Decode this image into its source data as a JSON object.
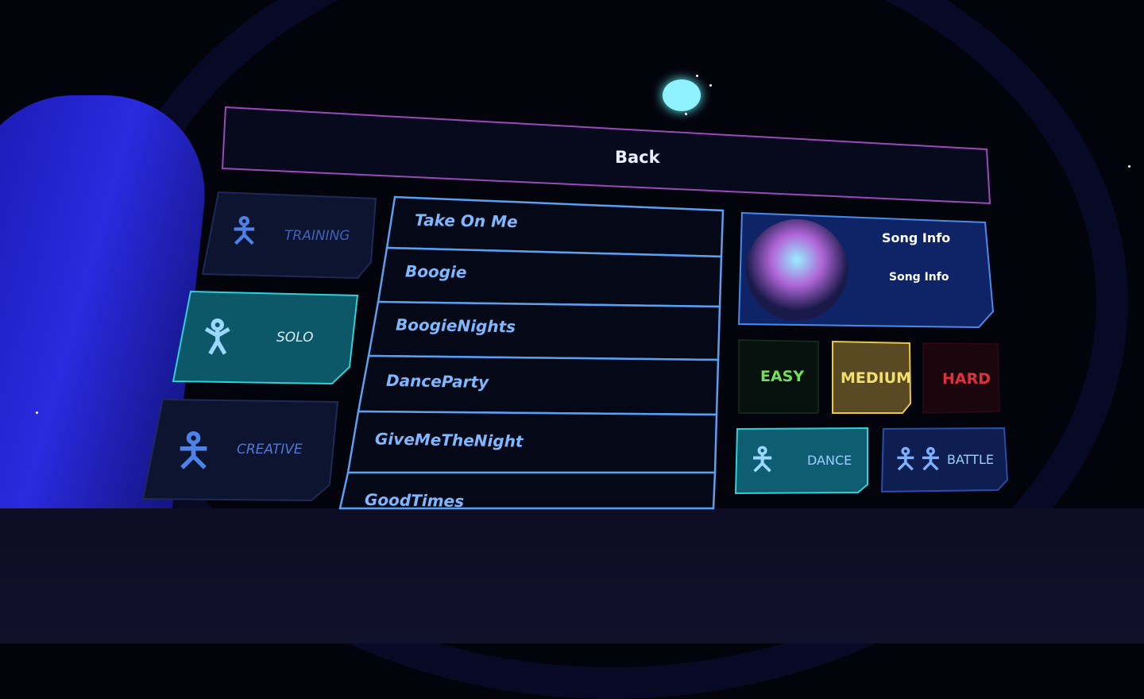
{
  "header": {
    "back_label": "Back"
  },
  "modes": [
    {
      "label": "TRAINING",
      "icon": "trainer-figure-icon",
      "selected": false
    },
    {
      "label": "SOLO",
      "icon": "guitar-player-icon",
      "selected": true
    },
    {
      "label": "CREATIVE",
      "icon": "creative-figure-icon",
      "selected": false
    }
  ],
  "songs": [
    "Take On Me",
    "Boogie",
    "BoogieNights",
    "DanceParty",
    "GiveMeTheNight",
    "GoodTimes"
  ],
  "song_info": {
    "title": "Song Info",
    "subtitle": "Song Info",
    "art": "album-art"
  },
  "difficulty": {
    "easy": "EASY",
    "medium": "MEDIUM",
    "hard": "HARD",
    "selected": "MEDIUM"
  },
  "play_modes": [
    {
      "label": "DANCE",
      "icon": "dancer-icon",
      "selected": true
    },
    {
      "label": "BATTLE",
      "icon": "battle-icon",
      "selected": false
    }
  ],
  "colors": {
    "accent_cyan": "#2fd0d8",
    "easy": "#6fe05a",
    "medium": "#f0e070",
    "hard": "#e03040",
    "panel_border": "#4a8ae8"
  }
}
